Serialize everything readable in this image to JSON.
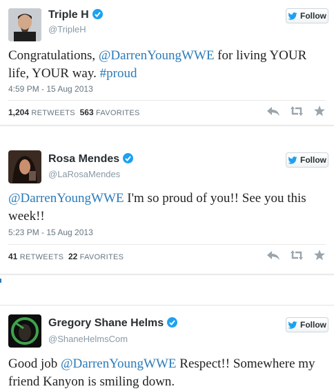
{
  "follow_label": "Follow",
  "brand_color": "#1da1f2",
  "link_color": "#2b7bb9",
  "tweets": [
    {
      "name": "Triple H",
      "handle": "@TripleH",
      "text_parts": [
        "Congratulations,  ",
        "@DarrenYoungWWE",
        " for living YOUR life, YOUR way.  ",
        "#proud"
      ],
      "timestamp": "4:59 PM - 15 Aug 2013",
      "retweets": "1,204",
      "retweets_label": "RETWEETS",
      "favorites": "563",
      "favorites_label": "FAVORITES"
    },
    {
      "name": "Rosa Mendes",
      "handle": "@LaRosaMendes",
      "text_parts": [
        "@DarrenYoungWWE",
        " I'm so proud of you!! See you this week!!"
      ],
      "timestamp": "5:23 PM - 15 Aug 2013",
      "retweets": "41",
      "retweets_label": "RETWEETS",
      "favorites": "22",
      "favorites_label": "FAVORITES"
    },
    {
      "name": "Gregory Shane Helms",
      "handle": "@ShaneHelmsCom",
      "text_parts": [
        "Good job ",
        "@DarrenYoungWWE",
        " Respect!! Somewhere my friend Kanyon is smiling down."
      ]
    }
  ],
  "icons": [
    "verified-badge-icon",
    "twitter-bird-icon",
    "reply-icon",
    "retweet-icon",
    "favorite-star-icon"
  ]
}
